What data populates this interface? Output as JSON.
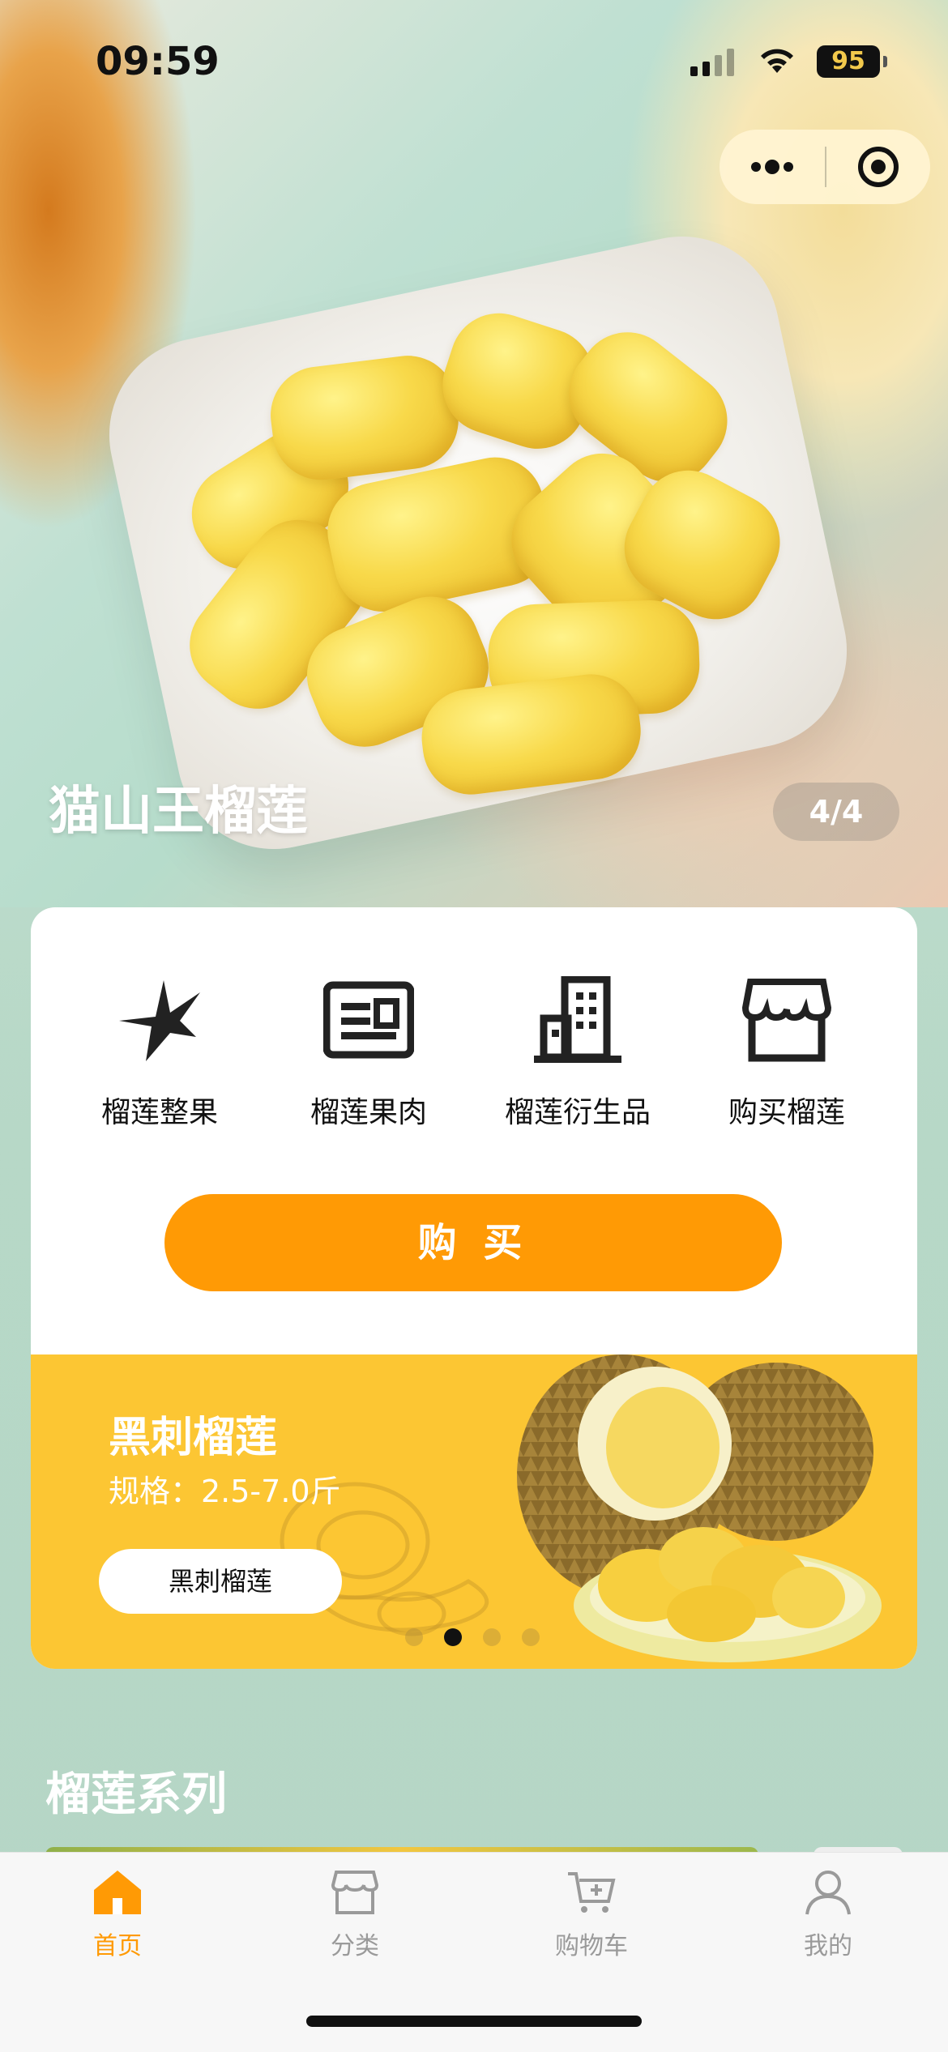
{
  "status_bar": {
    "time": "09:59",
    "battery": "95"
  },
  "hero": {
    "title": "猫山王榴莲",
    "pager": "4/4"
  },
  "quick_nav": [
    {
      "label": "榴莲整果",
      "icon": "star-burst-icon"
    },
    {
      "label": "榴莲果肉",
      "icon": "id-card-icon"
    },
    {
      "label": "榴莲衍生品",
      "icon": "building-icon"
    },
    {
      "label": "购买榴莲",
      "icon": "store-icon"
    }
  ],
  "buy_button": "购 买",
  "banner": {
    "title": "黑刺榴莲",
    "spec": "规格：2.5-7.0斤",
    "button": "黑刺榴莲",
    "slide_index": 2,
    "slide_count": 4
  },
  "section_title": "榴莲系列",
  "tabs": [
    {
      "label": "首页",
      "icon": "home-icon",
      "active": true
    },
    {
      "label": "分类",
      "icon": "category-store-icon",
      "active": false
    },
    {
      "label": "购物车",
      "icon": "cart-icon",
      "active": false
    },
    {
      "label": "我的",
      "icon": "user-icon",
      "active": false
    }
  ],
  "colors": {
    "accent": "#ff9a05",
    "banner": "#fcc633"
  }
}
